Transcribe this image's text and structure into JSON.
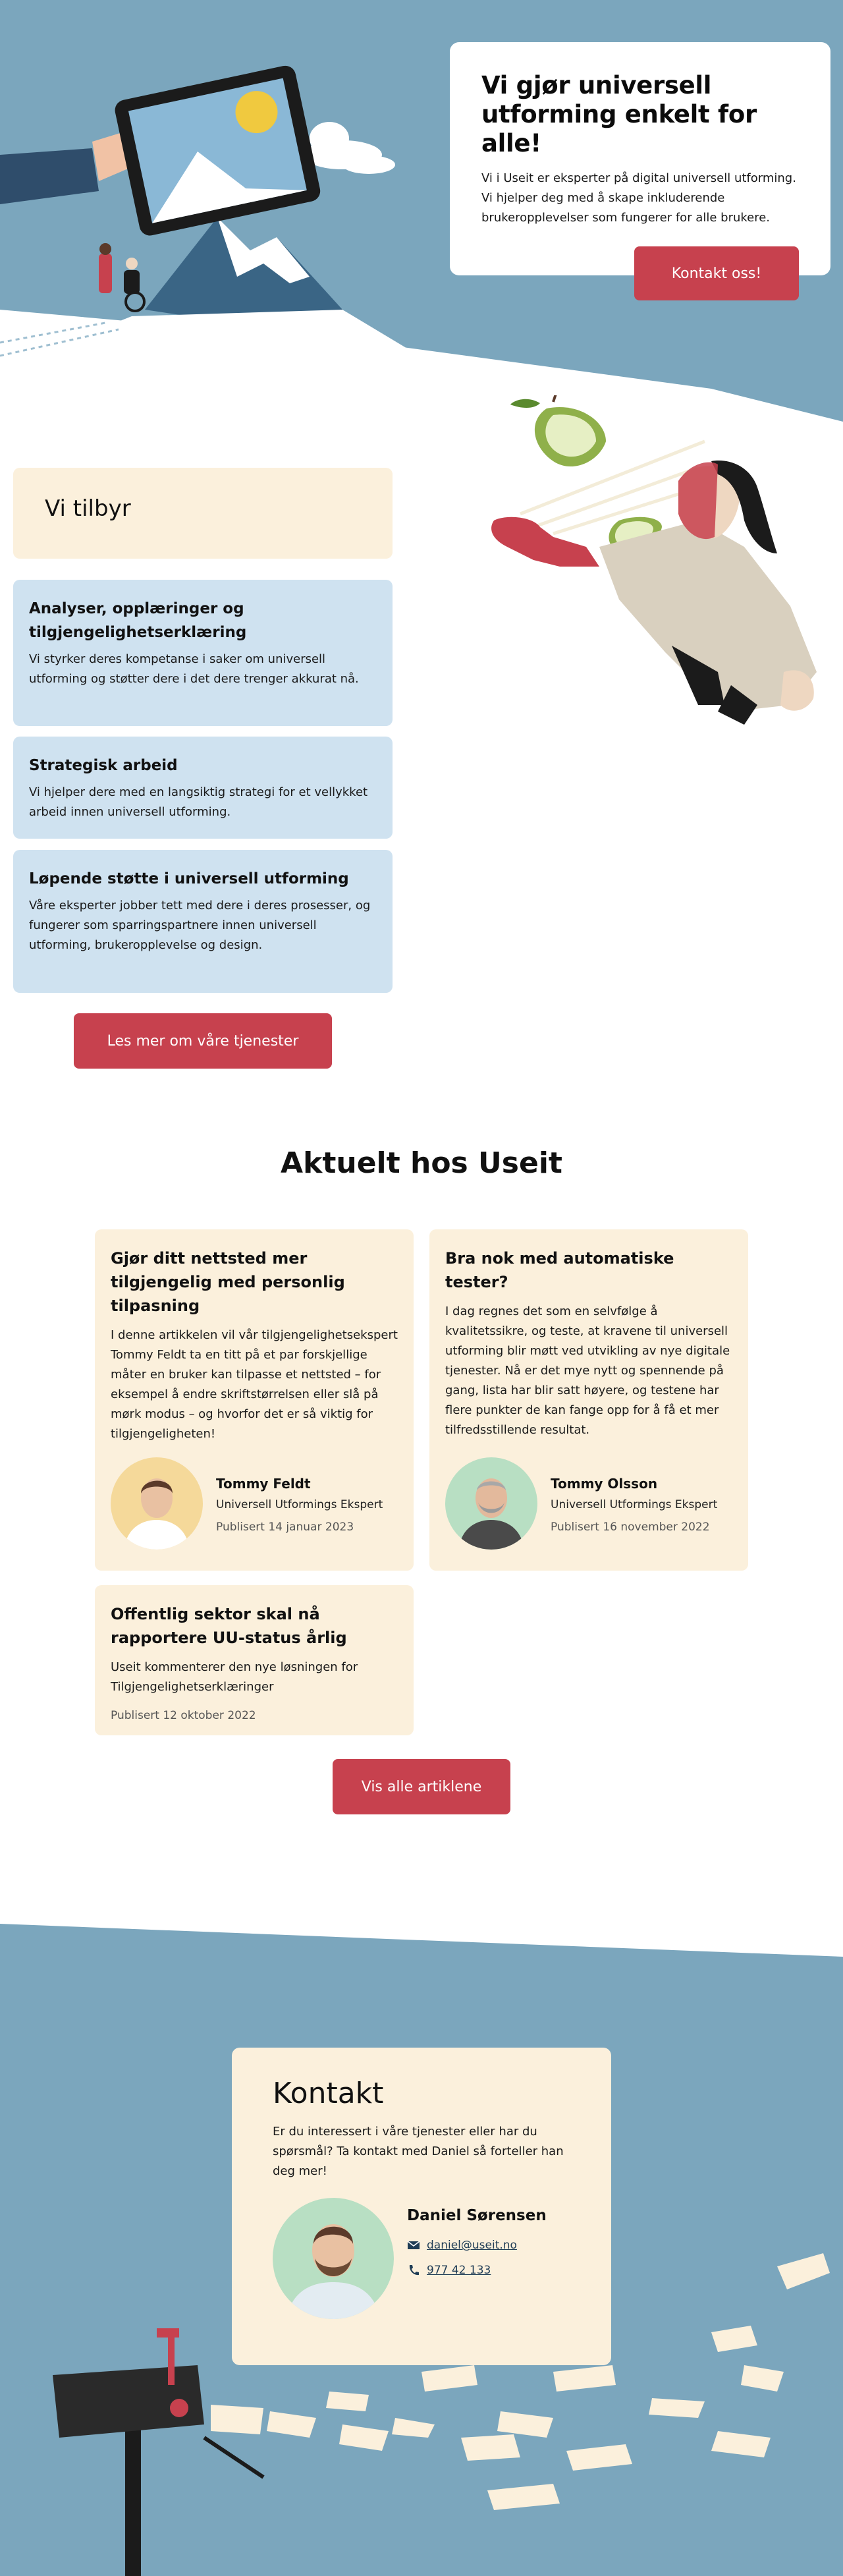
{
  "hero": {
    "title": "Vi gjør universell utforming enkelt for alle!",
    "text": "Vi i Useit er eksperter på digital universell utforming. Vi hjelper deg med å skape inkluderende brukeropplevelser som fungerer for alle brukere.",
    "cta": "Kontakt oss!"
  },
  "offer": {
    "heading": "Vi tilbyr",
    "items": [
      {
        "title": "Analyser, opplæringer og tilgjengelighetserklæring",
        "text": "Vi styrker deres kompetanse i saker om universell utforming og støtter dere i det dere trenger akkurat nå."
      },
      {
        "title": "Strategisk arbeid",
        "text": "Vi hjelper dere med en langsiktig strategi for et vellykket arbeid innen universell utforming."
      },
      {
        "title": "Løpende støtte i universell utforming",
        "text": "Våre eksperter jobber tett med dere i deres prosesser, og fungerer som sparringspartnere innen universell utforming, brukeropplevelse og design."
      }
    ],
    "cta": "Les mer om våre tjenester"
  },
  "news": {
    "heading": "Aktuelt hos Useit",
    "articles": [
      {
        "title": "Gjør ditt nettsted mer tilgjengelig med personlig tilpasning",
        "text": "I denne artikkelen vil vår tilgjengelighetsekspert Tommy Feldt ta en titt på et par forskjellige måter en bruker kan tilpasse et nettsted – for eksempel å endre skriftstørrelsen eller slå på mørk modus – og hvorfor det er så viktig for tilgjengeligheten!",
        "author": "Tommy Feldt",
        "role": "Universell Utformings Ekspert",
        "date": "Publisert 14 januar 2023"
      },
      {
        "title": "Bra nok med automatiske tester?",
        "text": "I dag regnes det som en selvfølge å kvalitetssikre, og teste, at kravene til universell utforming blir møtt ved utvikling av nye digitale tjenester. Nå er det mye nytt og spennende på gang, lista har blir satt høyere, og testene har flere punkter de kan fange opp for å få et mer tilfredsstillende resultat.",
        "author": "Tommy Olsson",
        "role": "Universell Utformings Ekspert",
        "date": "Publisert 16 november 2022"
      },
      {
        "title": "Offentlig sektor skal nå rapportere UU-status årlig",
        "text": "Useit kommenterer den nye løsningen for Tilgjengelighetserklæringer",
        "date": "Publisert 12 oktober 2022"
      }
    ],
    "cta": "Vis alle artiklene"
  },
  "contact": {
    "heading": "Kontakt",
    "text": "Er du interessert i våre tjenester eller har du spørsmål? Ta kontakt med Daniel så forteller han deg mer!",
    "name": "Daniel Sørensen",
    "email": "daniel@useit.no",
    "phone": "977 42 133"
  },
  "colors": {
    "accent": "#c7414e",
    "sky": "#7ba6bd",
    "cream": "#fbf0dc",
    "lightblue": "#cfe2f0"
  }
}
